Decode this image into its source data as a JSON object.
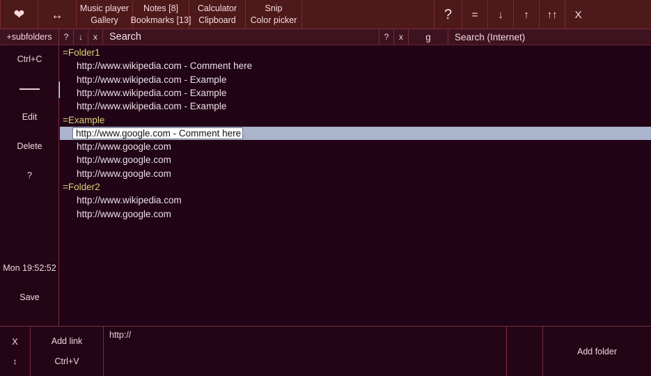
{
  "header": {
    "heart_icon": "heart-icon",
    "resize_icon": "horizontal-arrows-icon",
    "menu": [
      {
        "top": "Music player",
        "bottom": "Gallery"
      },
      {
        "top": "Notes [8]",
        "bottom": "Bookmarks [13]"
      },
      {
        "top": "Calculator",
        "bottom": "Clipboard"
      },
      {
        "top": "Snip",
        "bottom": "Color picker"
      }
    ],
    "help": "?",
    "buttons": [
      {
        "name": "menu-button",
        "glyph": "="
      },
      {
        "name": "minimize-button",
        "glyph": "↓"
      },
      {
        "name": "restore-button",
        "glyph": "↑"
      },
      {
        "name": "maximize-button",
        "glyph": "↑↑"
      },
      {
        "name": "close-button",
        "glyph": "X"
      }
    ]
  },
  "searchbar": {
    "subfolders": "+subfolders",
    "help": "?",
    "down": "↓",
    "clear": "x",
    "search_placeholder": "Search",
    "right_help": "?",
    "right_clear": "x",
    "engine": "g",
    "internet_placeholder": "Search (Internet)"
  },
  "sidebar": {
    "copy": "Ctrl+C",
    "divider": "—",
    "edit": "Edit",
    "delete": "Delete",
    "help": "?",
    "clock": "Mon  19:52:52",
    "save": "Save"
  },
  "list": {
    "rows": [
      {
        "type": "folder",
        "text": "=Folder1"
      },
      {
        "type": "link",
        "text": "http://www.wikipedia.com - Comment here"
      },
      {
        "type": "link",
        "text": "http://www.wikipedia.com - Example"
      },
      {
        "type": "link",
        "text": "http://www.wikipedia.com - Example"
      },
      {
        "type": "link",
        "text": "http://www.wikipedia.com - Example"
      },
      {
        "type": "folder",
        "text": "=Example"
      },
      {
        "type": "editing",
        "text": "http://www.google.com - Comment here"
      },
      {
        "type": "link",
        "text": "http://www.google.com"
      },
      {
        "type": "link",
        "text": "http://www.google.com"
      },
      {
        "type": "link",
        "text": "http://www.google.com"
      },
      {
        "type": "folder",
        "text": "=Folder2"
      },
      {
        "type": "link",
        "text": "http://www.wikipedia.com"
      },
      {
        "type": "link",
        "text": "http://www.google.com"
      }
    ]
  },
  "bottom": {
    "close": "X",
    "resize": "↕",
    "add_link": "Add link",
    "paste": "Ctrl+V",
    "url_value": "http://",
    "add_folder": "Add folder"
  },
  "colors": {
    "window_bg": "#210415",
    "header_bg": "#4e1919",
    "searchbar_bg": "#3d1320",
    "border": "#7a2a3a",
    "folder_text": "#d9d27a",
    "link_text": "#ece0e6",
    "selection": "#aab4cc",
    "edit_bg": "#ffffff"
  }
}
